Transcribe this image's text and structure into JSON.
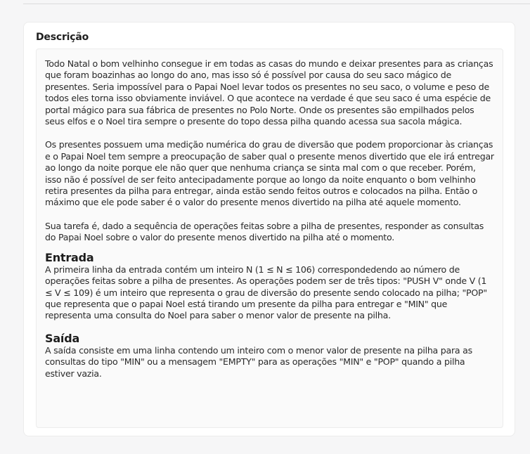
{
  "card": {
    "title": "Descrição"
  },
  "description": {
    "paragraphs": [
      "Todo Natal o bom velhinho consegue ir em todas as casas do mundo e deixar presentes para as crianças que foram boazinhas ao longo do ano, mas isso só é possível por causa do seu saco mágico de presentes. Seria impossível para o Papai Noel levar todos os presentes no seu saco, o volume e peso de todos eles torna isso obviamente inviável. O que acontece na verdade é que seu saco é uma espécie de portal mágico para sua fábrica de presentes no Polo Norte. Onde os presentes são empilhados pelos seus elfos e o Noel tira sempre o presente do topo dessa pilha quando acessa sua sacola mágica.",
      "Os presentes possuem uma medição numérica do grau de diversão que podem proporcionar às crianças e o Papai Noel tem sempre a preocupação de saber qual o presente menos divertido que ele irá entregar ao longo da noite porque ele não quer que nenhuma criança se sinta mal com o que receber. Porém, isso não é possível de ser feito antecipadamente porque ao longo da noite enquanto o bom velhinho retira presentes da pilha para entregar, ainda estão sendo feitos outros e colocados na pilha. Então o máximo que ele pode saber é o valor do presente menos divertido na pilha até aquele momento.",
      "Sua tarefa é, dado a sequência de operações feitas sobre a pilha de presentes, responder as consultas do Papai Noel sobre o valor do presente menos divertido na pilha até o momento."
    ]
  },
  "input_section": {
    "heading": "Entrada",
    "text": "A primeira linha da entrada contém um inteiro N (1 ≤ N ≤ 106) correspondedendo ao número de operações feitas sobre a pilha de presentes. As operações podem ser de três tipos: \"PUSH V\" onde V (1 ≤ V ≤ 109) é um inteiro que representa o grau de diversão do presente sendo colocado na pilha; \"POP\" que representa que o papai Noel está tirando um presente da pilha para entregar e \"MIN\" que representa uma consulta do Noel para saber o menor valor de presente na pilha."
  },
  "output_section": {
    "heading": "Saída",
    "text": "A saída consiste em uma linha contendo um inteiro com o menor valor de presente na pilha para as consultas do tipo \"MIN\" ou a mensagem \"EMPTY\" para as operações \"MIN\" e \"POP\" quando a pilha estiver vazia."
  }
}
